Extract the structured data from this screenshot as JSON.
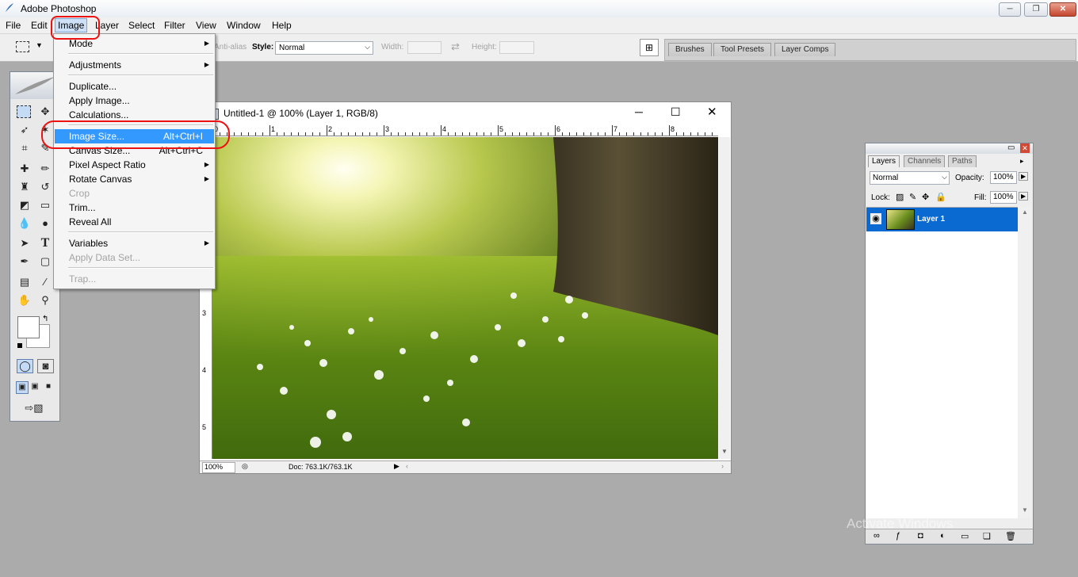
{
  "app_title": "Adobe Photoshop",
  "window_controls": {
    "minimize": "─",
    "restore": "❐",
    "close": "✕"
  },
  "menubar": [
    "File",
    "Edit",
    "Image",
    "Layer",
    "Select",
    "Filter",
    "View",
    "Window",
    "Help"
  ],
  "options": {
    "antialias": "Anti-alias",
    "style_label": "Style:",
    "style_value": "Normal",
    "width_label": "Width:",
    "height_label": "Height:",
    "swap_glyph": "⇄"
  },
  "palette_well": [
    "Brushes",
    "Tool Presets",
    "Layer Comps"
  ],
  "image_menu": {
    "mode": "Mode",
    "adjustments": "Adjustments",
    "duplicate": "Duplicate...",
    "apply_image": "Apply Image...",
    "calculations": "Calculations...",
    "image_size": "Image Size...",
    "image_size_sc": "Alt+Ctrl+I",
    "canvas_size": "Canvas Size...",
    "canvas_size_sc": "Alt+Ctrl+C",
    "pixel_aspect": "Pixel Aspect Ratio",
    "rotate_canvas": "Rotate Canvas",
    "crop": "Crop",
    "trim": "Trim...",
    "reveal_all": "Reveal All",
    "variables": "Variables",
    "apply_data_set": "Apply Data Set...",
    "trap": "Trap..."
  },
  "document": {
    "title": "Untitled-1 @ 100% (Layer 1, RGB/8)",
    "ruler_top": [
      "0",
      "1",
      "2",
      "3",
      "4",
      "5",
      "6",
      "7",
      "8"
    ],
    "ruler_left": [
      "3",
      "4",
      "5"
    ],
    "zoom": "100%",
    "doc_info": "Doc: 763.1K/763.1K"
  },
  "layers_panel": {
    "tabs": [
      "Layers",
      "Channels",
      "Paths"
    ],
    "blend_mode": "Normal",
    "opacity_label": "Opacity:",
    "opacity_value": "100%",
    "lock_label": "Lock:",
    "fill_label": "Fill:",
    "fill_value": "100%",
    "layer_name": "Layer 1"
  },
  "watermark": "Activate Windows",
  "colors": {
    "highlight": "#3399ff",
    "annotation": "#e11111",
    "layer_selected": "#0a6ad2"
  }
}
